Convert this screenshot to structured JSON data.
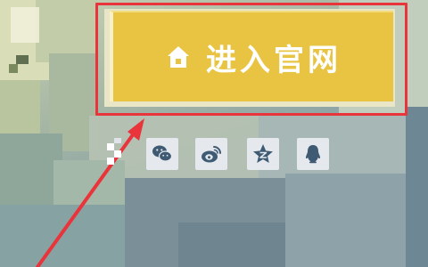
{
  "enter_button": {
    "label": "进入官网",
    "icon": "home-icon"
  },
  "social_links": [
    {
      "name": "share-icon",
      "partial": true
    },
    {
      "name": "wechat-icon"
    },
    {
      "name": "weibo-icon"
    },
    {
      "name": "qzone-icon"
    },
    {
      "name": "qq-icon"
    }
  ],
  "colors": {
    "button": "#e9c442",
    "highlight": "#e8343a",
    "social_bg": "#e5e9ee",
    "social_icon": "#3f5a73"
  }
}
